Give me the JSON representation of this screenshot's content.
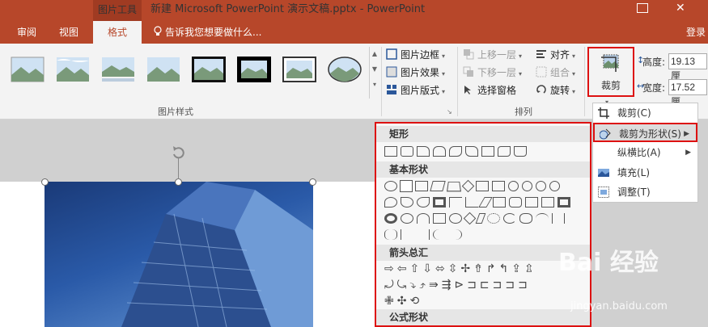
{
  "titlebar": {
    "context_tab": "图片工具",
    "doc_title": "新建 Microsoft PowerPoint 演示文稿.pptx  -  PowerPoint",
    "close_glyph": "✕"
  },
  "tabs": [
    {
      "label": "审阅"
    },
    {
      "label": "视图"
    },
    {
      "label": "格式"
    }
  ],
  "tell_me": "告诉我您想要做什么...",
  "login": "登录",
  "ribbon": {
    "picture_styles_label": "图片样式",
    "arrange_label": "排列",
    "picture_border": "图片边框",
    "picture_effects": "图片效果",
    "picture_layout": "图片版式",
    "bring_forward": "上移一层",
    "send_backward": "下移一层",
    "selection_pane": "选择窗格",
    "align": "对齐",
    "group": "组合",
    "rotate": "旋转",
    "crop": "裁剪",
    "height_label": "高度:",
    "height_value": "19.13 厘",
    "width_label": "宽度:",
    "width_value": "17.52 厘"
  },
  "shapes_panel": {
    "cat_rect": "矩形",
    "cat_basic": "基本形状",
    "cat_arrows": "箭头总汇",
    "cat_equation": "公式形状"
  },
  "menu": {
    "crop": "裁剪(C)",
    "crop_to_shape": "裁剪为形状(S)",
    "aspect_ratio": "纵横比(A)",
    "fill": "填充(L)",
    "fit": "调整(T)"
  },
  "watermark": {
    "text": "Bai 经验",
    "url": "jingyan.baidu.com"
  },
  "colors": {
    "accent": "#b7472a",
    "highlight": "#d11111"
  }
}
